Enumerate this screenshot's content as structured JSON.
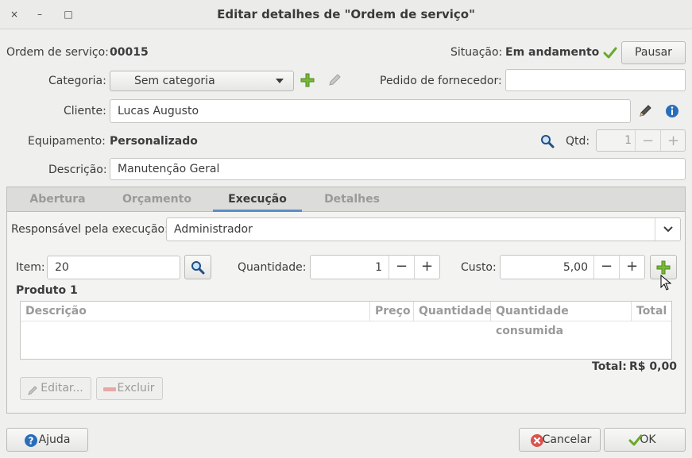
{
  "window": {
    "title": "Editar detalhes de \"Ordem de serviço\"",
    "close": "×",
    "minimize": "–",
    "maximize": "□"
  },
  "header": {
    "order_label": "Ordem de serviço:",
    "order_value": "00015",
    "status_label": "Situação:",
    "status_value": "Em andamento",
    "pause_label": "Pausar",
    "category_label": "Categoria:",
    "category_value": "Sem categoria",
    "supplier_label": "Pedido de fornecedor:",
    "supplier_value": "",
    "client_label": "Cliente:",
    "client_value": "Lucas Augusto",
    "equipment_label": "Equipamento:",
    "equipment_value": "Personalizado",
    "qty_label": "Qtd:",
    "qty_value": "1",
    "description_label": "Descrição:",
    "description_value": "Manutenção Geral"
  },
  "tabs": [
    {
      "label": "Abertura",
      "active": false
    },
    {
      "label": "Orçamento",
      "active": false
    },
    {
      "label": "Execução",
      "active": true
    },
    {
      "label": "Detalhes",
      "active": false
    }
  ],
  "execution": {
    "responsible_label": "Responsável pela execução:",
    "responsible_value": "Administrador",
    "item_label": "Item:",
    "item_value": "20",
    "quantity_label": "Quantidade:",
    "quantity_value": "1",
    "cost_label": "Custo:",
    "cost_value": "5,00",
    "minus": "−",
    "plus": "+",
    "product_label": "Produto 1",
    "columns": [
      "Descrição",
      "Preço",
      "Quantidade",
      "Quantidade consumida",
      "Total"
    ],
    "rows": [],
    "total_label": "Total:",
    "total_value": "R$ 0,00",
    "edit_label": "Editar...",
    "delete_label": "Excluir"
  },
  "footer": {
    "help_label": "Ajuda",
    "cancel_label": "Cancelar",
    "ok_label": "OK"
  },
  "colors": {
    "accent": "#5b8ec9",
    "green": "#6aa92a",
    "red": "#d9534f",
    "info": "#2a6ebb"
  },
  "icons": [
    "close-icon",
    "minimize-icon",
    "maximize-icon",
    "check-icon",
    "add-icon",
    "edit-pencil-icon",
    "info-icon",
    "search-icon",
    "chevron-down-icon",
    "help-icon",
    "cancel-icon",
    "ok-check-icon",
    "mouse-cursor-icon"
  ]
}
